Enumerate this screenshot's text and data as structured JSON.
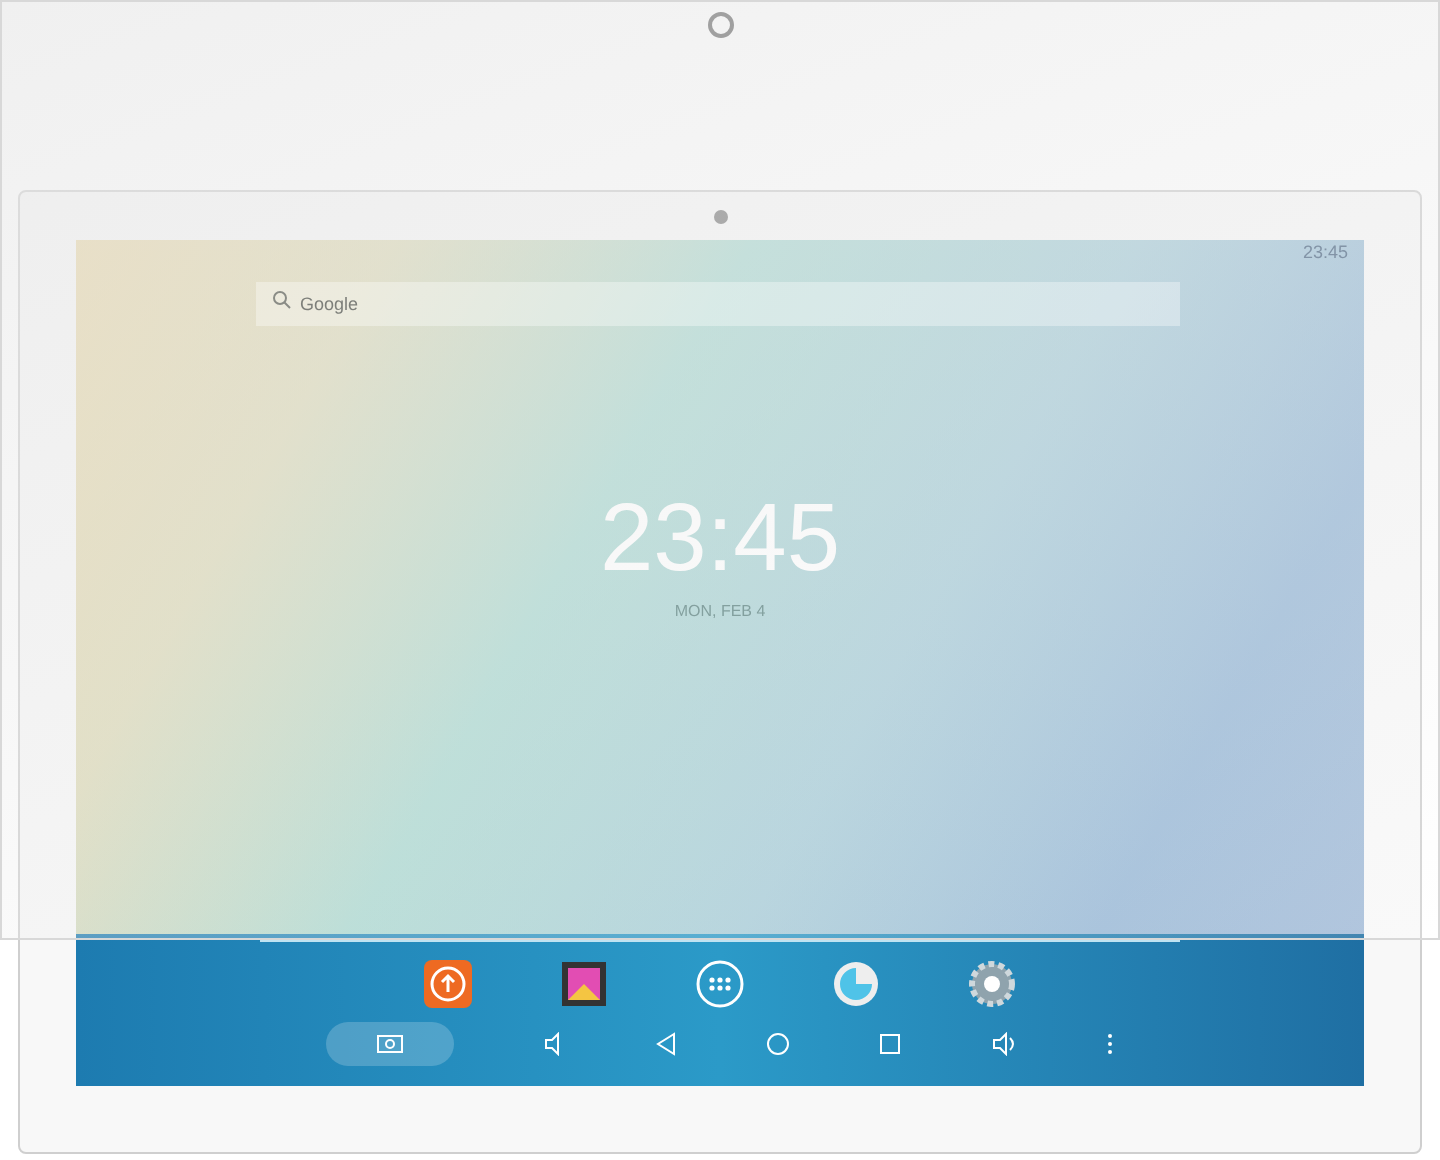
{
  "status_bar": {
    "time": "23:45"
  },
  "search": {
    "placeholder": "Google"
  },
  "clock": {
    "time": "23:45",
    "date": "MON, FEB 4"
  }
}
